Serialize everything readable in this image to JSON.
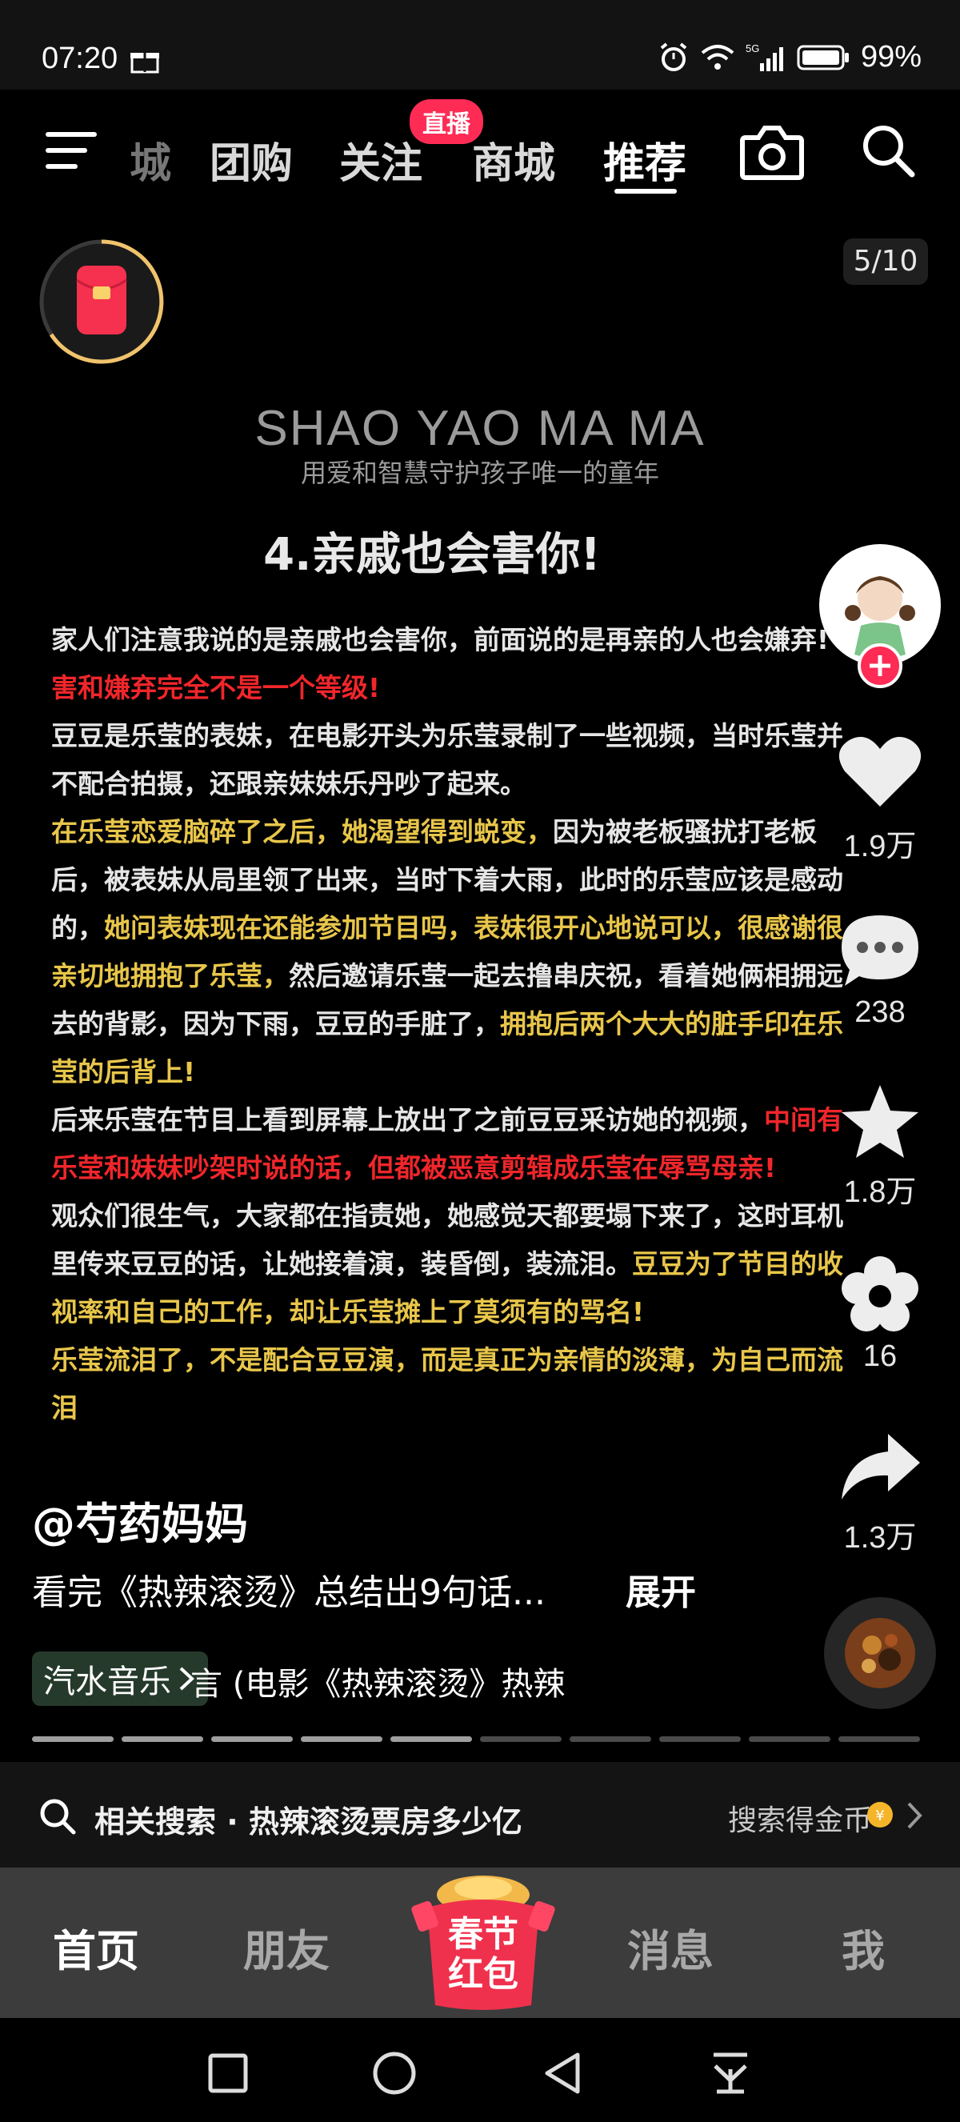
{
  "status_bar": {
    "time": "07:20",
    "battery": "99%",
    "network": "5G"
  },
  "top_nav": {
    "tabs": [
      "城",
      "团购",
      "关注",
      "商城",
      "推荐"
    ],
    "live_badge": "直播",
    "active_tab": "推荐"
  },
  "post": {
    "image_counter": "5/10",
    "brand_title": "SHAO YAO MA MA",
    "brand_subtitle": "用爱和智慧守护孩子唯一的童年",
    "heading": "4.亲戚也会害你!",
    "paragraphs": [
      [
        {
          "t": "家人们注意我说的是亲戚也会害你，前面说的是再亲的人也会嫌弃! ",
          "c": "w"
        },
        {
          "t": "害和嫌弃完全不是一个等级!",
          "c": "r"
        }
      ],
      [
        {
          "t": "豆豆是乐莹的表妹，在电影开头为乐莹录制了一些视频，当时乐莹并不配合拍摄，还跟亲妹妹乐丹吵了起来。",
          "c": "w"
        }
      ],
      [
        {
          "t": "在乐莹恋爱脑碎了之后，她渴望得到蜕变，",
          "c": "y"
        },
        {
          "t": "因为被老板骚扰打老板后，被表妹从局里领了出来，当时下着大雨，此时的乐莹应该是感动的，",
          "c": "w"
        },
        {
          "t": "她问表妹现在还能参加节目吗，表妹很开心地说可以，很感谢很亲切地拥抱了乐莹，",
          "c": "y"
        },
        {
          "t": "然后邀请乐莹一起去撸串庆祝，看着她俩相拥远去的背影，因为下雨，豆豆的手脏了，",
          "c": "w"
        },
        {
          "t": "拥抱后两个大大的脏手印在乐莹的后背上!",
          "c": "y"
        }
      ],
      [
        {
          "t": "后来乐莹在节目上看到屏幕上放出了之前豆豆采访她的视频，",
          "c": "w"
        },
        {
          "t": "中间有乐莹和妹妹吵架时说的话，但都被恶意剪辑成乐莹在辱骂母亲!",
          "c": "r"
        }
      ],
      [
        {
          "t": "观众们很生气，大家都在指责她，她感觉天都要塌下来了，这时耳机里传来豆豆的话，让她接着演，装昏倒，装流泪。",
          "c": "w"
        },
        {
          "t": "豆豆为了节目的收视率和自己的工作，却让乐莹摊上了莫须有的骂名!",
          "c": "y"
        }
      ],
      [
        {
          "t": "乐莹流泪了，不是配合豆豆演，而是真正为亲情的淡薄，为自己而流泪",
          "c": "y"
        }
      ]
    ],
    "author": "@芍药妈妈",
    "description": "看完《热辣滚烫》总结出9句话...",
    "expand_label": "展开",
    "music_chip": "汽水音乐",
    "music_song": "言 (电影《热辣滚烫》热辣",
    "progress_total": 10,
    "progress_current": 5
  },
  "right_rail": {
    "like_count": "1.9万",
    "comment_count": "238",
    "favorite_count": "1.8万",
    "flower_count": "16",
    "share_count": "1.3万"
  },
  "related_search": {
    "text": "相关搜索 · 热辣滚烫票房多少亿",
    "reward": "搜索得金币"
  },
  "bottom_tabs": {
    "home": "首页",
    "friends": "朋友",
    "center_line1": "春节",
    "center_line2": "红包",
    "messages": "消息",
    "me": "我"
  },
  "colors": {
    "accent_red": "#fe2c55",
    "text_yellow": "#e8c64a",
    "text_red": "#f0262b"
  }
}
